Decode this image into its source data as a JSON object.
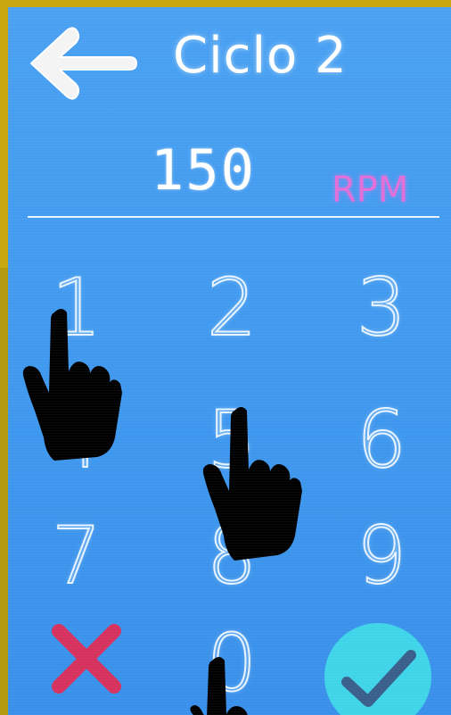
{
  "header": {
    "title": "Ciclo 2",
    "back_icon": "arrow-left-icon"
  },
  "display": {
    "value": "150",
    "unit": "RPM"
  },
  "keypad": {
    "keys": [
      "1",
      "2",
      "3",
      "4",
      "5",
      "6",
      "7",
      "8",
      "9",
      "0"
    ],
    "cancel_icon": "close-x-icon",
    "confirm_icon": "checkmark-icon"
  },
  "overlay": {
    "hand_icon": "pointing-hand-icon"
  },
  "colors": {
    "screen_bg": "#4aa1f2",
    "bezel": "#c8a80e",
    "unit_text": "#e06fd9",
    "cancel": "#d6325e",
    "confirm": "#3fd4e8",
    "digit": "#e8f4ff"
  }
}
